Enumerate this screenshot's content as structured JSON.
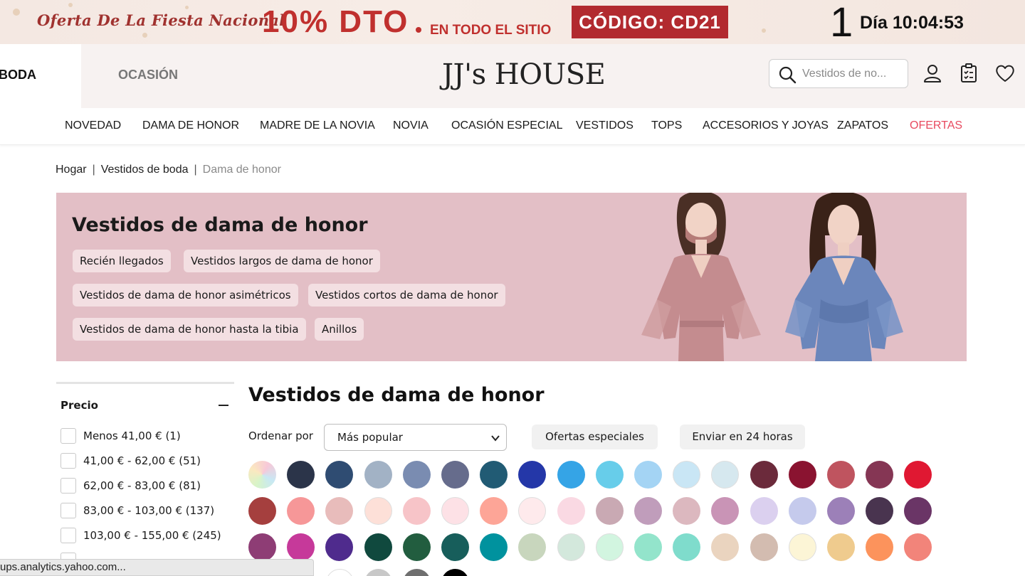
{
  "promo": {
    "tagline": "Oferta De La Fiesta Nacional",
    "discount": "10% DTO",
    "sitewide": "EN TODO EL SITIO",
    "code": "CÓDIGO: CD21",
    "countdown_days": "1",
    "countdown_text": "Día 10:04:53"
  },
  "header": {
    "tab_wedding": "BODA",
    "tab_occasion": "OCASIÓN",
    "logo": "JJ's HOUSE",
    "search_placeholder": "Vestidos de no..."
  },
  "nav": {
    "items": [
      "NOVEDAD",
      "DAMA DE HONOR",
      "MADRE DE LA NOVIA",
      "NOVIA",
      "OCASIÓN ESPECIAL",
      "VESTIDOS",
      "TOPS",
      "ACCESORIOS Y JOYAS",
      "ZAPATOS",
      "OFERTAS"
    ]
  },
  "breadcrumb": {
    "items": [
      "Hogar",
      "Vestidos de boda",
      "Dama de honor"
    ]
  },
  "hero": {
    "title": "Vestidos de dama de honor",
    "chips": [
      "Recién llegados",
      "Vestidos largos de dama de honor",
      "Vestidos de dama de honor asimétricos",
      "Vestidos cortos de dama de honor",
      "Vestidos de dama de honor hasta la tibia",
      "Anillos"
    ]
  },
  "filter": {
    "title": "Precio",
    "options": [
      "Menos 41,00 € (1)",
      "41,00 € - 62,00 € (51)",
      "62,00 € - 83,00 € (81)",
      "83,00 € - 103,00 € (137)",
      "103,00 € - 155,00 € (245)"
    ]
  },
  "products": {
    "title": "Vestidos de dama de honor",
    "sort_label": "Ordenar por",
    "sort_value": "Más popular",
    "special_offers": "Ofertas especiales",
    "ship_24h": "Enviar en 24 horas"
  },
  "colors": {
    "row1": [
      "multicolor",
      "#2b3449",
      "#2f4c72",
      "#a2b2c5",
      "#7a8cb1",
      "#666c8c",
      "#215b74",
      "#2437a8",
      "#35a4e6",
      "#67cdea",
      "#a4d4f4",
      "#c9e6f5",
      "#d6e8ef",
      "#6b2a3b",
      "#8a1330",
      "#bf545f",
      "#853654",
      "#e01832"
    ],
    "row2": [
      "#a53f3e",
      "#f69798",
      "#e8bcbb",
      "#fde0d8",
      "#f7c4c8",
      "#fde1e6",
      "#fda597",
      "#feeaec",
      "#fad9e3",
      "#c9a9b3",
      "#c09dbb",
      "#dcb8bf",
      "#c994b6",
      "#dbd0ef",
      "#c5caec",
      "#9c80b8",
      "#49344f",
      "#6a3566"
    ],
    "row3": [
      "#8e3d75",
      "#c6399a",
      "#4f2b8d",
      "#10493e",
      "#225d3f",
      "#175e5b",
      "#00929e",
      "#c8d6bd",
      "#d3e8dc",
      "#d2f5e0",
      "#93e4cb",
      "#7fdccc",
      "#ead4bf",
      "#d3bcb0",
      "#fcf5d6",
      "#efcb8e",
      "#fc935c",
      "#f2847a"
    ],
    "accent_sale": "#e84a5f",
    "hero_bg": "#e3bfc6"
  },
  "statusbar": {
    "text": "ups.analytics.yahoo.com..."
  }
}
